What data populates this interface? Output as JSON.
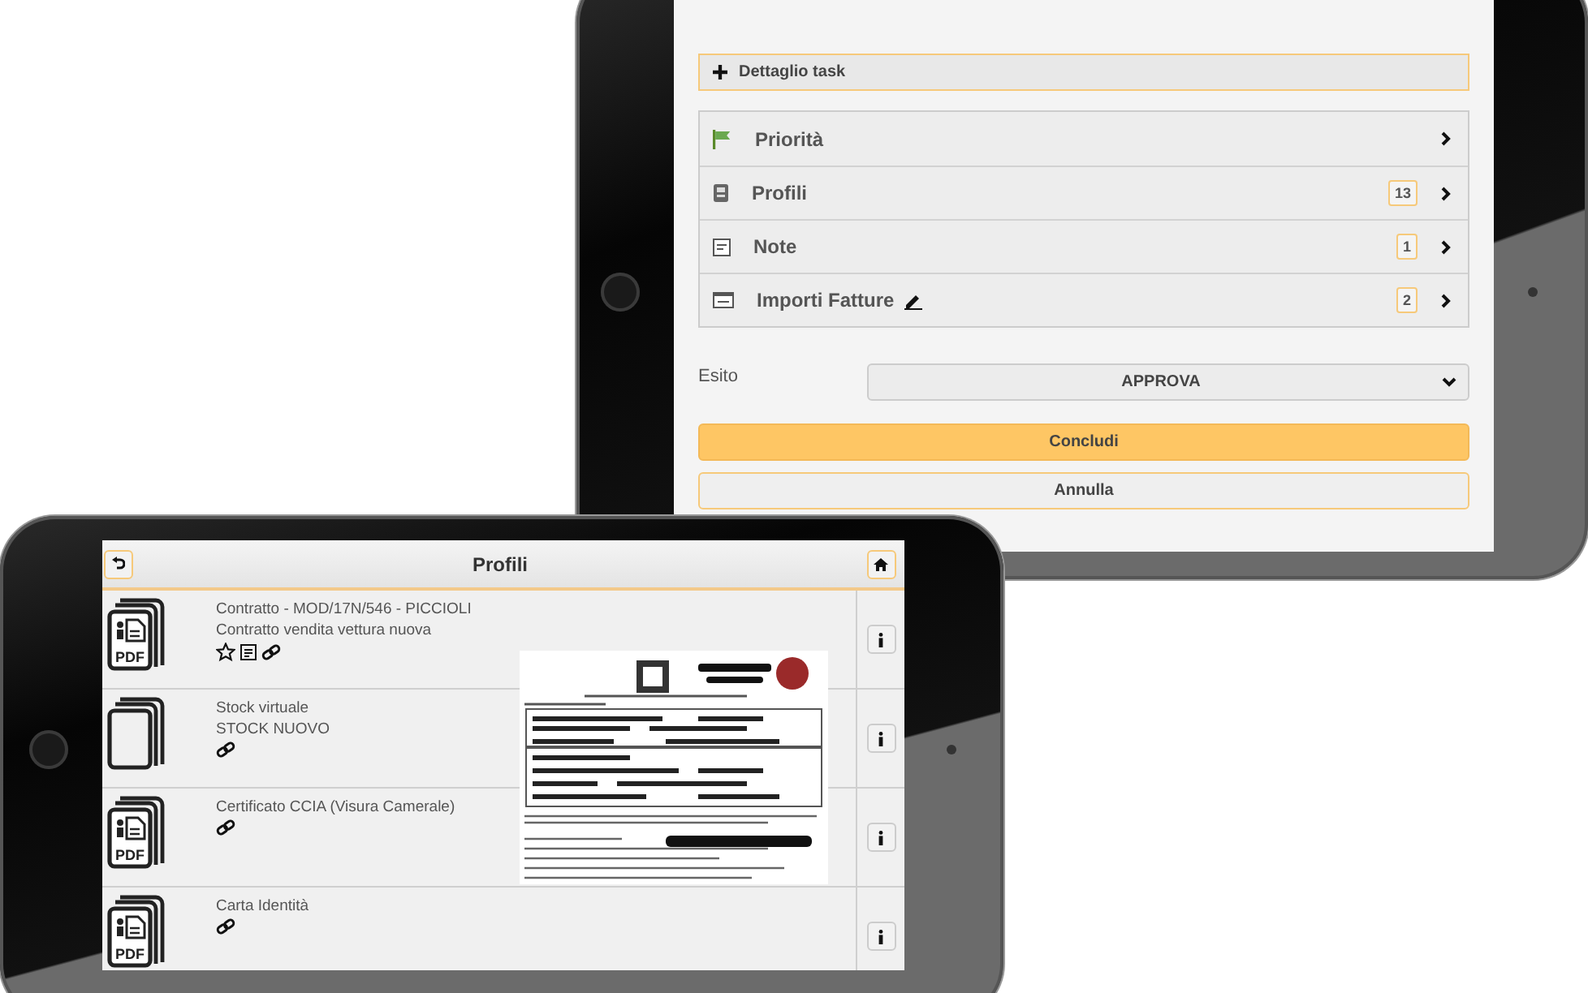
{
  "back_tablet": {
    "detail_header": {
      "label": "Dettaglio task"
    },
    "sections": [
      {
        "label": "Priorità",
        "kind": "flag",
        "editable": false
      },
      {
        "label": "Profili",
        "kind": "profile",
        "badge": "13",
        "editable": false
      },
      {
        "label": "Note",
        "kind": "note",
        "badge": "1",
        "editable": false
      },
      {
        "label": "Importi Fatture",
        "kind": "invoice",
        "badge": "2",
        "editable": true
      }
    ],
    "outcome": {
      "label": "Esito",
      "value": "APPROVA"
    },
    "buttons": [
      {
        "label": "Concludi",
        "kind": "primary"
      },
      {
        "label": "Annulla",
        "kind": "secondary"
      }
    ]
  },
  "front_tablet": {
    "title": "Profili",
    "documents": [
      {
        "title": "Contratto - MOD/17N/546 - PICCIOLI",
        "subtitle": "Contratto vendita vettura nuova",
        "kind": "pdf",
        "file_label": "PDF",
        "actions": [
          {
            "kind": "star"
          },
          {
            "kind": "note"
          },
          {
            "kind": "link"
          }
        ]
      },
      {
        "title": "Stock virtuale",
        "subtitle": "STOCK NUOVO",
        "kind": "blank",
        "actions": [
          {
            "kind": "link"
          }
        ]
      },
      {
        "title": "Certificato CCIA (Visura Camerale)",
        "kind": "pdf",
        "file_label": "PDF",
        "actions": [
          {
            "kind": "link"
          }
        ]
      },
      {
        "title": "Carta Identità",
        "kind": "pdf",
        "file_label": "PDF",
        "actions": [
          {
            "kind": "link"
          }
        ]
      }
    ]
  }
}
